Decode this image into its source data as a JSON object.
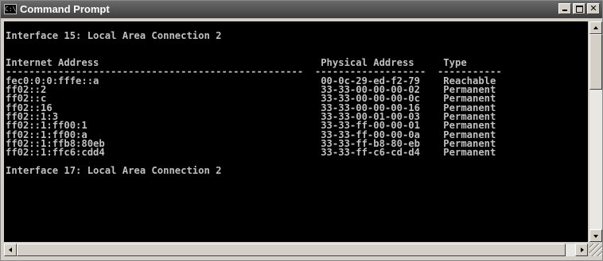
{
  "window": {
    "title": "Command Prompt",
    "icon": "console-icon",
    "icon_glyph": "C:\\",
    "buttons": {
      "minimize": "minimize",
      "maximize": "maximize",
      "close": "✕"
    }
  },
  "console": {
    "lines": [
      "",
      "Interface 15: Local Area Connection 2",
      "",
      "",
      "Internet Address                                      Physical Address     Type",
      "---------------------------------------------------  -------------------  -----------",
      "fec0:0:0:fffe::a                                      00-0c-29-ed-f2-79    Reachable",
      "ff02::2                                               33-33-00-00-00-02    Permanent",
      "ff02::c                                               33-33-00-00-00-0c    Permanent",
      "ff02::16                                              33-33-00-00-00-16    Permanent",
      "ff02::1:3                                             33-33-00-01-00-03    Permanent",
      "ff02::1:ff00:1                                        33-33-ff-00-00-01    Permanent",
      "ff02::1:ff00:a                                        33-33-ff-00-00-0a    Permanent",
      "ff02::1:ffb8:80eb                                     33-33-ff-b8-80-eb    Permanent",
      "ff02::1:ffc6:cdd4                                     33-33-ff-c6-cd-d4    Permanent",
      "",
      "Interface 17: Local Area Connection 2",
      "",
      "",
      "",
      "",
      "",
      ""
    ]
  },
  "colors": {
    "console_bg": "#000000",
    "console_fg": "#c0c0c0",
    "titlebar": "#4a4a4a"
  }
}
